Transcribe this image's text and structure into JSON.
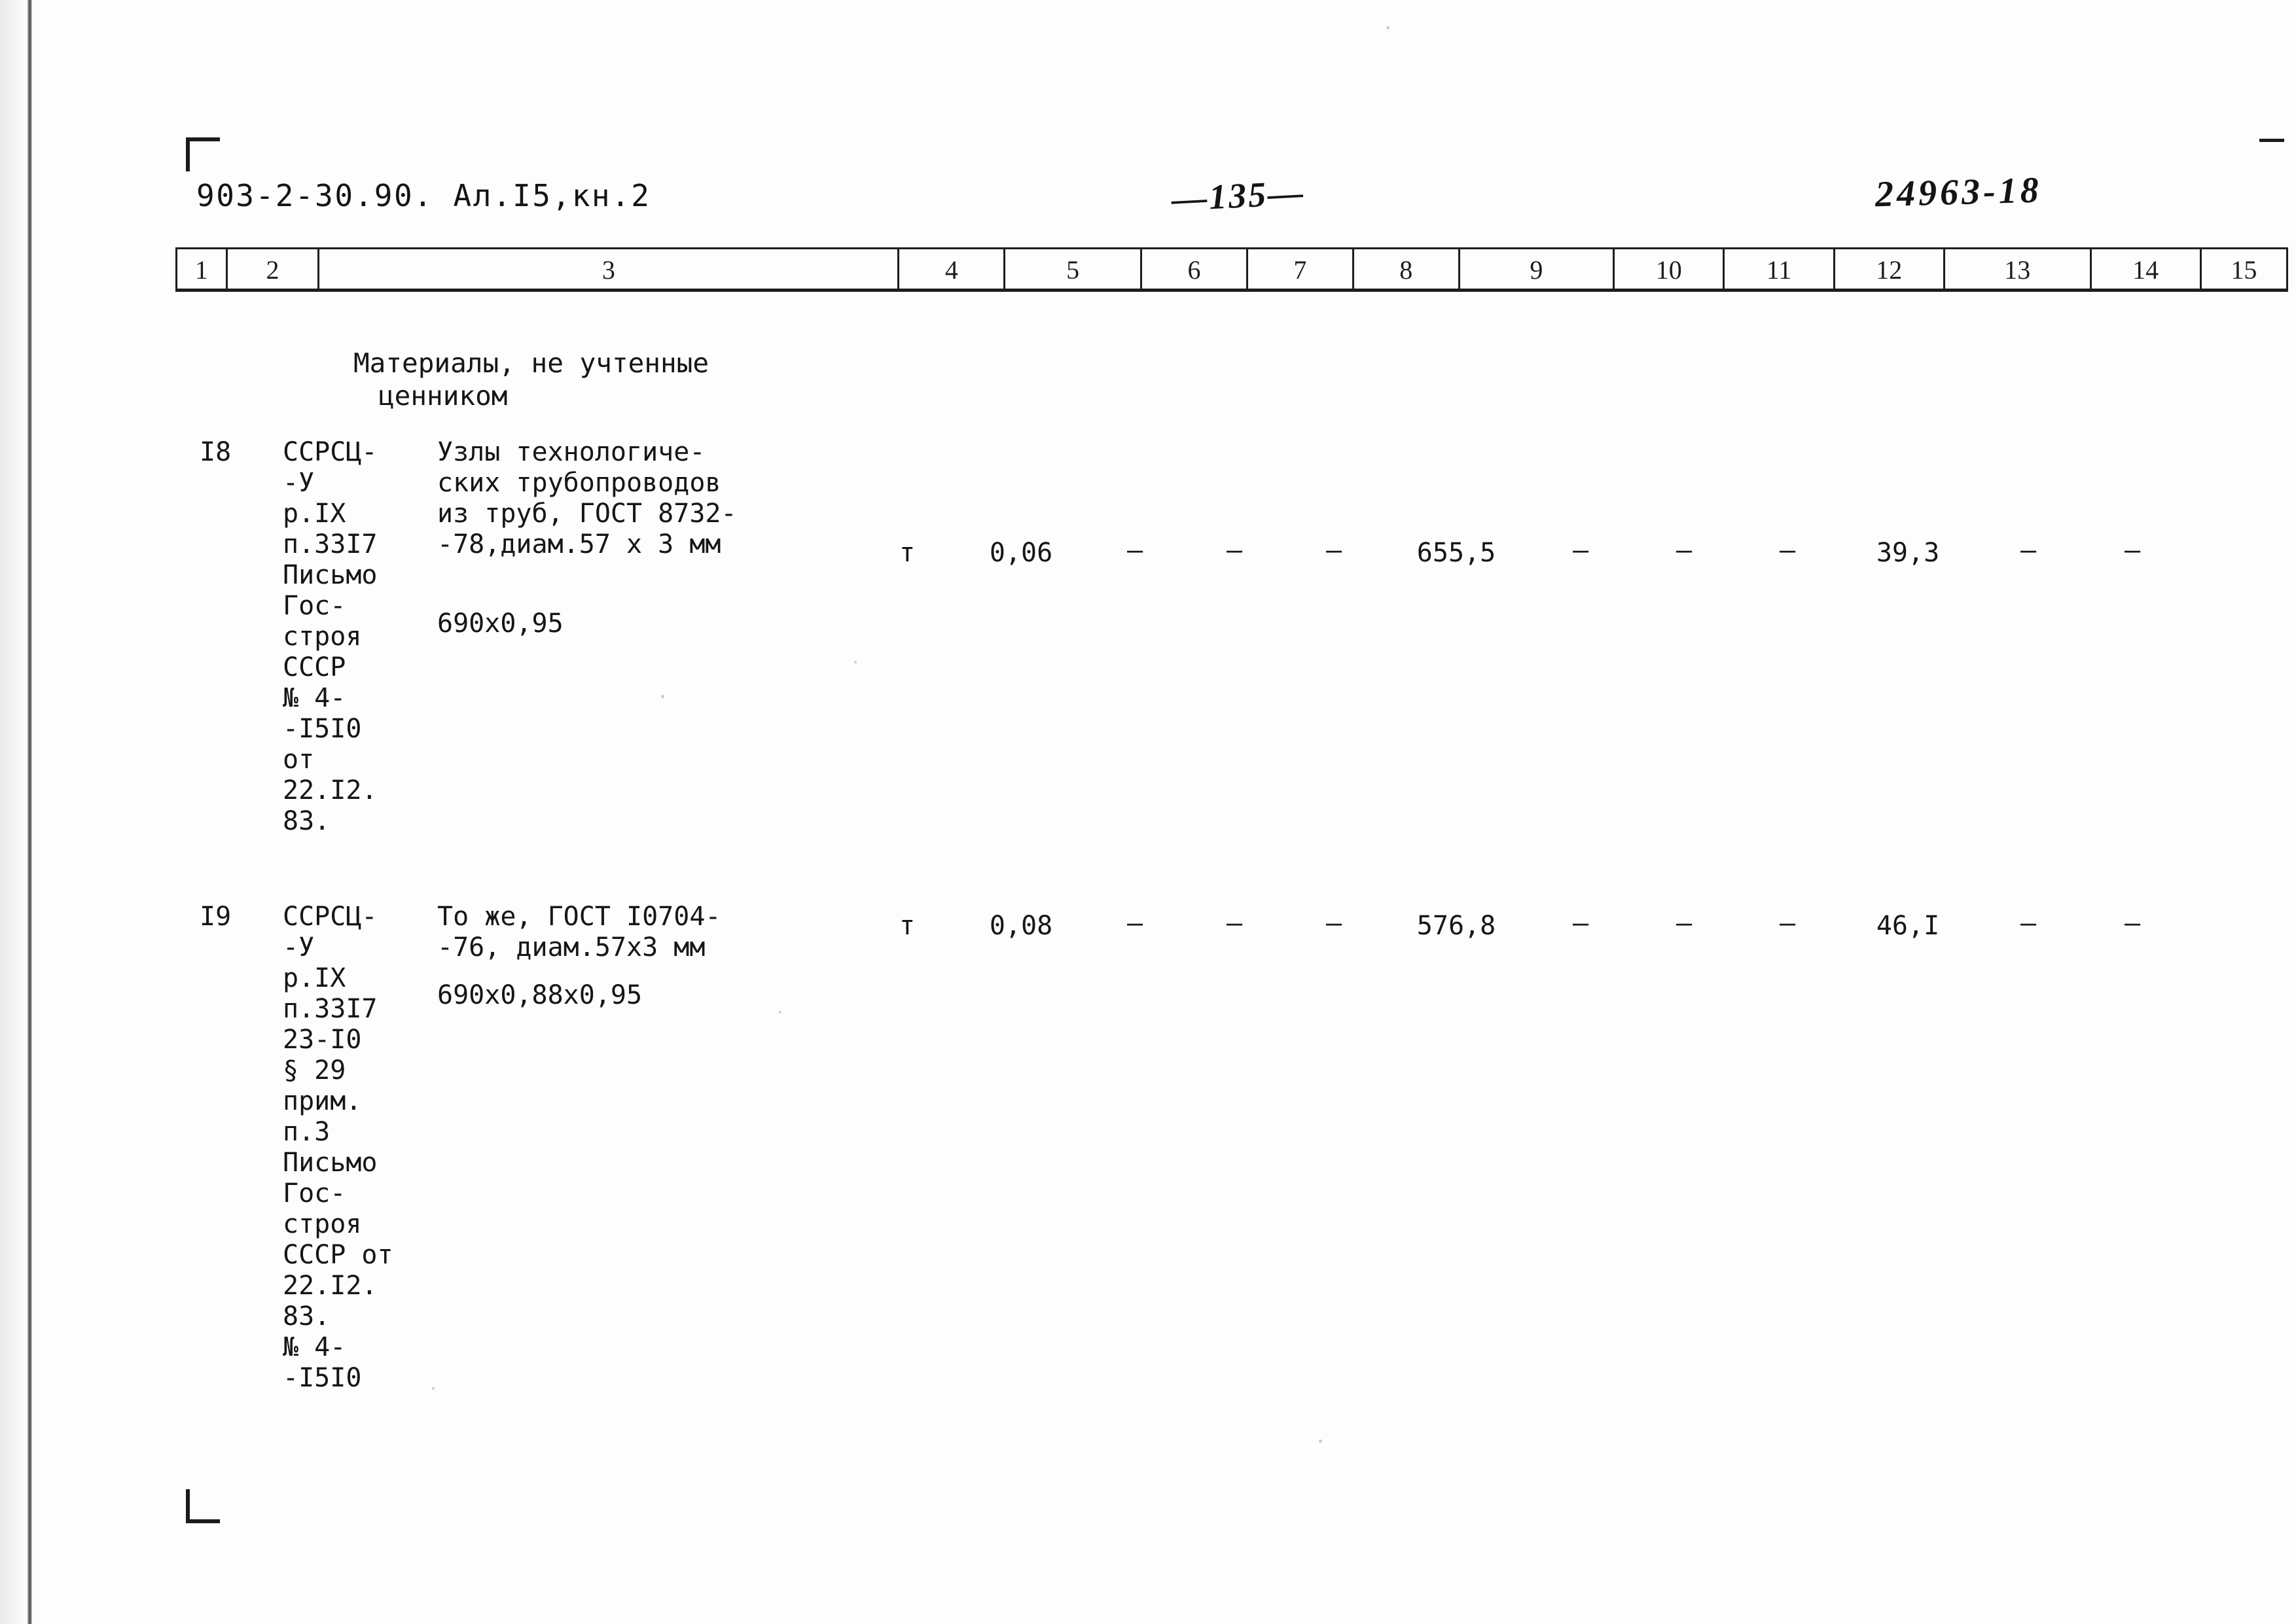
{
  "header": {
    "doc_code": "903-2-30.90. Ал.I5,кн.2",
    "page_number": "—135—",
    "archive_code": "24963-18"
  },
  "table": {
    "column_headers": [
      "1",
      "2",
      "3",
      "4",
      "5",
      "6",
      "7",
      "8",
      "9",
      "10",
      "11",
      "12",
      "13",
      "14",
      "15"
    ],
    "section_title_lines": [
      "Материалы, не учтенные",
      "ценником"
    ],
    "rows": [
      {
        "num": "I8",
        "justification_lines": [
          "ССРСЦ-",
          "-У",
          "р.IX",
          "п.33I7",
          "Письмо",
          "Гос-",
          "строя",
          "СССР",
          "№ 4-",
          "-I5I0",
          "от",
          "22.I2.",
          "83."
        ],
        "description_lines": [
          "Узлы технологиче-",
          "ских трубопроводов",
          "из труб, ГОСТ 8732-",
          "-78,диам.57 х 3 мм"
        ],
        "coefficient": "690х0,95",
        "unit": "т",
        "quantity": "0,06",
        "c6": "—",
        "c7": "—",
        "c8": "—",
        "c9": "655,5",
        "c10": "—",
        "c11": "—",
        "c12": "—",
        "c13": "39,3",
        "c14": "—",
        "c15": "—"
      },
      {
        "num": "I9",
        "justification_lines": [
          "ССРСЦ-",
          "-У",
          "р.IX",
          "п.33I7",
          "23-I0",
          "§ 29",
          "прим.",
          "п.3",
          "Письмо",
          "Гос-",
          "строя",
          "СССР от",
          "22.I2.",
          "83.",
          "№ 4-",
          "-I5I0"
        ],
        "description_lines": [
          "То же, ГОСТ I0704-",
          "-76, диам.57х3 мм"
        ],
        "coefficient": "690х0,88х0,95",
        "unit": "т",
        "quantity": "0,08",
        "c6": "—",
        "c7": "—",
        "c8": "—",
        "c9": "576,8",
        "c10": "—",
        "c11": "—",
        "c12": "—",
        "c13": "46,I",
        "c14": "—",
        "c15": "—"
      }
    ]
  }
}
